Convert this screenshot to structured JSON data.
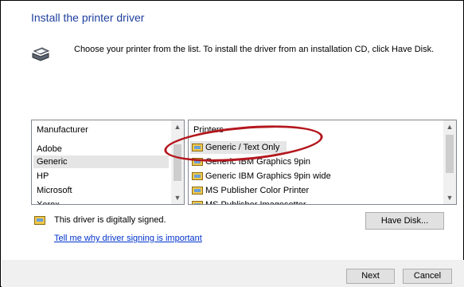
{
  "dialog": {
    "title": "Install the printer driver",
    "instructions": "Choose your printer from the list. To install the driver from an installation CD, click Have Disk."
  },
  "manufacturer_list": {
    "header": "Manufacturer",
    "items": [
      "Adobe",
      "Generic",
      "HP",
      "Microsoft",
      "Xerox"
    ],
    "selected": "Generic"
  },
  "printer_list": {
    "header": "Printers",
    "items": [
      "Generic / Text Only",
      "Generic IBM Graphics 9pin",
      "Generic IBM Graphics 9pin wide",
      "MS Publisher Color Printer",
      "MS Publisher Imagesetter"
    ],
    "selected": "Generic / Text Only"
  },
  "signing": {
    "status": "This driver is digitally signed.",
    "link": "Tell me why driver signing is important"
  },
  "buttons": {
    "have_disk": "Have Disk...",
    "next": "Next",
    "cancel": "Cancel"
  },
  "colors": {
    "title": "#1e3f9e",
    "annotation_circle": "#b3171d",
    "link": "#0033cc"
  }
}
